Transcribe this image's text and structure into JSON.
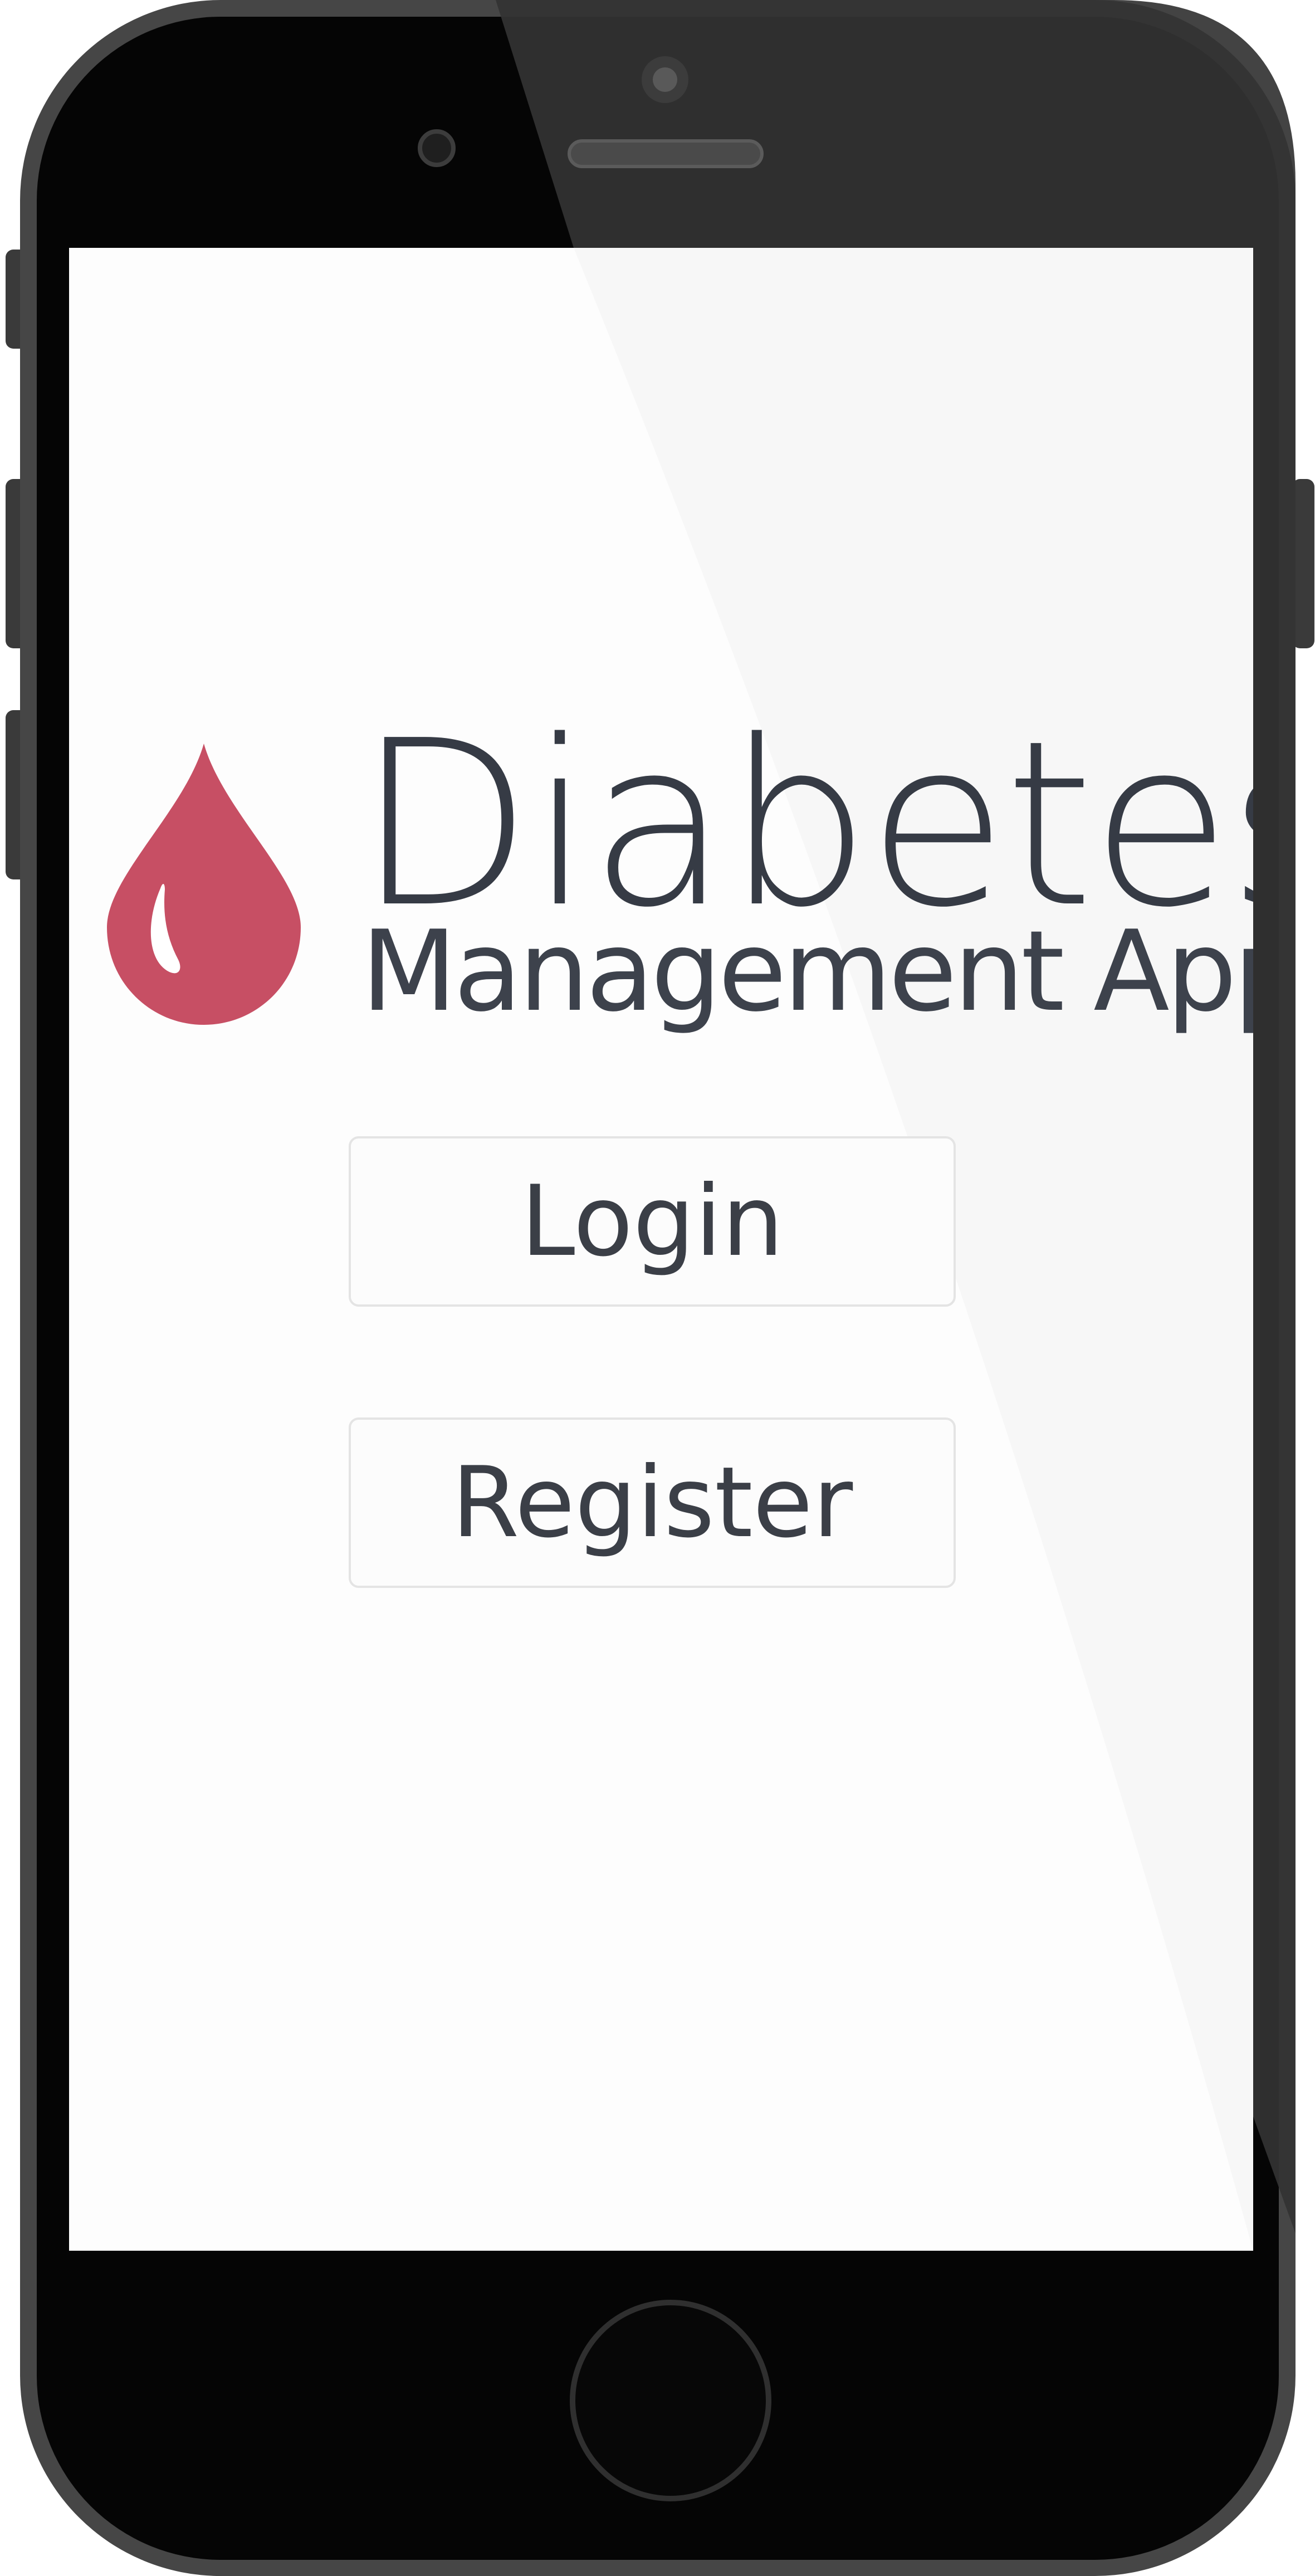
{
  "app": {
    "title": "Diabetes",
    "subtitle": "Management App",
    "brand_color": "#c74f64",
    "text_color": "#363b45"
  },
  "buttons": {
    "login_label": "Login",
    "register_label": "Register"
  },
  "icons": {
    "logo": "blood-drop-icon",
    "home": "home-button"
  }
}
